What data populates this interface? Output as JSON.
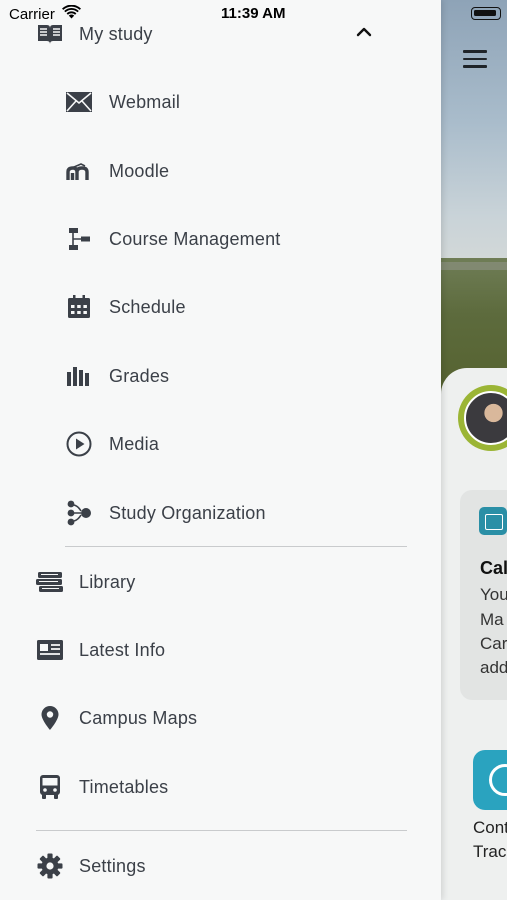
{
  "status_bar": {
    "carrier": "Carrier",
    "time": "11:39 AM"
  },
  "drawer": {
    "section_my_study": {
      "label": "My study",
      "expanded_icon": "chevron-up-icon"
    },
    "sub_items": [
      {
        "label": "Webmail",
        "icon": "envelope-icon"
      },
      {
        "label": "Moodle",
        "icon": "moodle-icon"
      },
      {
        "label": "Course Management",
        "icon": "sitemap-icon"
      },
      {
        "label": "Schedule",
        "icon": "calendar-icon"
      },
      {
        "label": "Grades",
        "icon": "bar-chart-icon"
      },
      {
        "label": "Media",
        "icon": "play-circle-icon"
      },
      {
        "label": "Study Organization",
        "icon": "node-tree-icon"
      }
    ],
    "items": [
      {
        "label": "Library",
        "icon": "books-icon"
      },
      {
        "label": "Latest Info",
        "icon": "newspaper-icon"
      },
      {
        "label": "Campus Maps",
        "icon": "map-pin-icon"
      },
      {
        "label": "Timetables",
        "icon": "bus-icon"
      }
    ],
    "settings": {
      "label": "Settings",
      "icon": "gear-icon"
    }
  },
  "background_app": {
    "card_title": "Cal",
    "card_lines": [
      "You",
      "Ma",
      "Car",
      "add"
    ],
    "tile_label_lines": [
      "Cont",
      "Track"
    ]
  }
}
